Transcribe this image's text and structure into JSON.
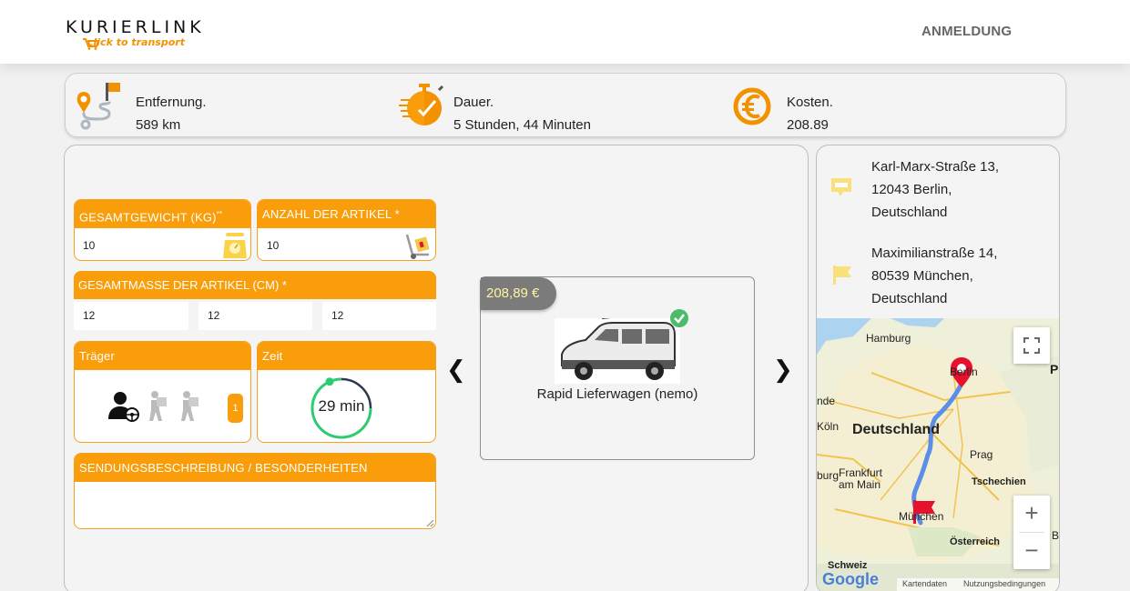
{
  "header": {
    "logo_word": "KURIERLINK",
    "logo_sub": "click to transport",
    "login": "ANMELDUNG"
  },
  "stats": {
    "distance_label": "Entfernung.",
    "distance_value": "589 km",
    "duration_label": "Dauer.",
    "duration_value": "5 Stunden, 44 Minuten",
    "cost_label": "Kosten.",
    "cost_value": "208.89"
  },
  "form": {
    "weight_label": "GESAMTGEWICHT (KG)",
    "weight_mark": "**",
    "weight_value": "10",
    "count_label": "ANZAHL DER ARTIKEL *",
    "count_value": "10",
    "mass_label": "GESAMTMASSE DER ARTIKEL (CM) *",
    "mass_values": [
      "12",
      "12",
      "12"
    ],
    "carrier_label": "Träger",
    "carrier_count": "1",
    "time_label": "Zeit",
    "time_value": "29 min",
    "description_label": "SENDUNGSBESCHREIBUNG / BESONDERHEITEN",
    "description_value": ""
  },
  "vehicle": {
    "price": "208,89 €",
    "name": "Rapid Lieferwagen (nemo)",
    "prev": "❮",
    "next": "❯"
  },
  "route": {
    "from": [
      "Karl-Marx-Straße 13,",
      "12043 Berlin,",
      "Deutschland"
    ],
    "to": [
      "Maximilianstraße 14,",
      "80539 München,",
      "Deutschland"
    ],
    "from_badge": "Start"
  },
  "map": {
    "labels": {
      "hamburg": "Hamburg",
      "berlin": "Berlin",
      "p": "P",
      "nde": "nde",
      "koln": "Köln",
      "deutschland": "Deutschland",
      "prag": "Prag",
      "frankfurt1": "Frankfurt",
      "frankfurt2": "am Main",
      "burg": "burg",
      "tschechien": "Tschechien",
      "munchen": "München",
      "osterreich": "Österreich",
      "b": "B",
      "schweiz": "Schweiz",
      "kartendaten": "Kartendaten",
      "nutzung": "Nutzungsbedingungen",
      "google": "Google"
    },
    "zoom_in": "+",
    "zoom_out": "−"
  },
  "colors": {
    "accent": "#f99d0a",
    "route": "#5b8ee6",
    "marker": "#e8112d"
  }
}
